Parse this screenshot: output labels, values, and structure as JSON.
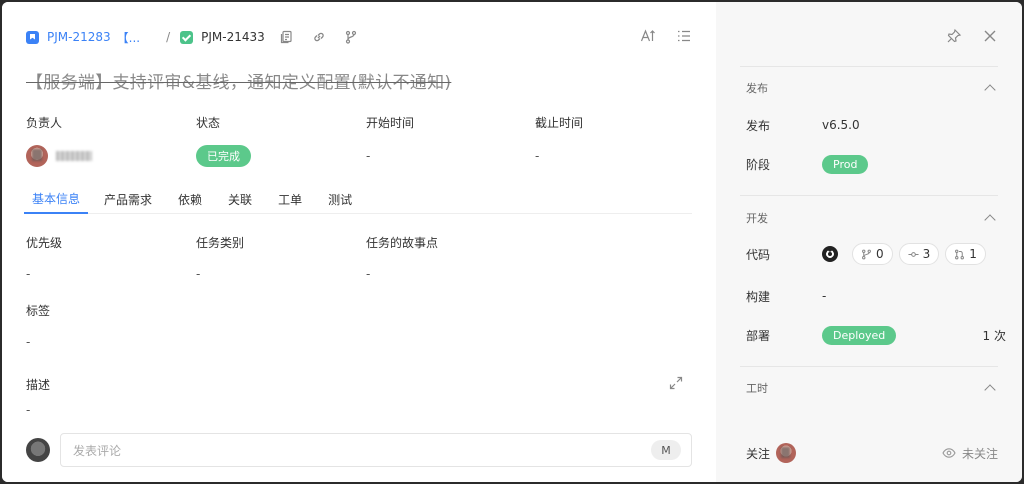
{
  "breadcrumb": {
    "parent_id": "PJM-21283",
    "parent_suffix": "【...",
    "separator": "/",
    "current_id": "PJM-21433"
  },
  "title": "【服务端】支持评审&基线，通知定义配置(默认不通知)",
  "fields": {
    "assignee_label": "负责人",
    "status_label": "状态",
    "status_value": "已完成",
    "start_label": "开始时间",
    "start_value": "-",
    "due_label": "截止时间",
    "due_value": "-"
  },
  "tabs": [
    "基本信息",
    "产品需求",
    "依赖",
    "关联",
    "工单",
    "测试"
  ],
  "basic": {
    "priority_label": "优先级",
    "priority_value": "-",
    "type_label": "任务类别",
    "type_value": "-",
    "points_label": "任务的故事点",
    "points_value": "-",
    "tags_label": "标签",
    "tags_value": "-",
    "desc_label": "描述",
    "desc_value": "-"
  },
  "comment": {
    "placeholder": "发表评论",
    "shortcut": "M"
  },
  "side": {
    "release_section": "发布",
    "release_label": "发布",
    "release_value": "v6.5.0",
    "stage_label": "阶段",
    "stage_value": "Prod",
    "dev_section": "开发",
    "code_label": "代码",
    "branches": "0",
    "commits": "3",
    "prs": "1",
    "build_label": "构建",
    "build_value": "-",
    "deploy_label": "部署",
    "deploy_value": "Deployed",
    "deploy_count": "1 次",
    "time_section": "工时",
    "follow_label": "关注",
    "unfollow_label": "未关注"
  },
  "colors": {
    "accent": "#3b82f6",
    "success": "#5cc98b"
  }
}
